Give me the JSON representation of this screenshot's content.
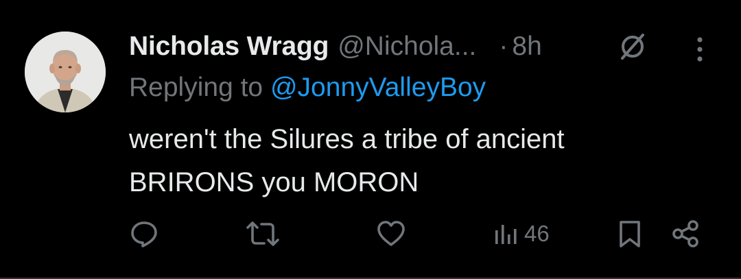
{
  "tweet": {
    "author": {
      "display_name": "Nicholas Wragg",
      "handle": "@Nichola...",
      "separator": "·",
      "time": "8h"
    },
    "replying_prefix": "Replying to",
    "replying_mention": "@JonnyValleyBoy",
    "text": "weren't the Silures a tribe of ancient BRIRONS you MORON",
    "actions": {
      "views_count": "46"
    }
  },
  "icons": {
    "status": "cancel-icon",
    "more": "more-icon",
    "reply": "reply-icon",
    "retweet": "retweet-icon",
    "like": "like-icon",
    "views": "views-icon",
    "bookmark": "bookmark-icon",
    "share": "share-icon"
  },
  "colors": {
    "background": "#000000",
    "primary_text": "#e7e9ea",
    "secondary_text": "#71767b",
    "mention": "#1d9bf0",
    "divider": "#2f3336"
  }
}
